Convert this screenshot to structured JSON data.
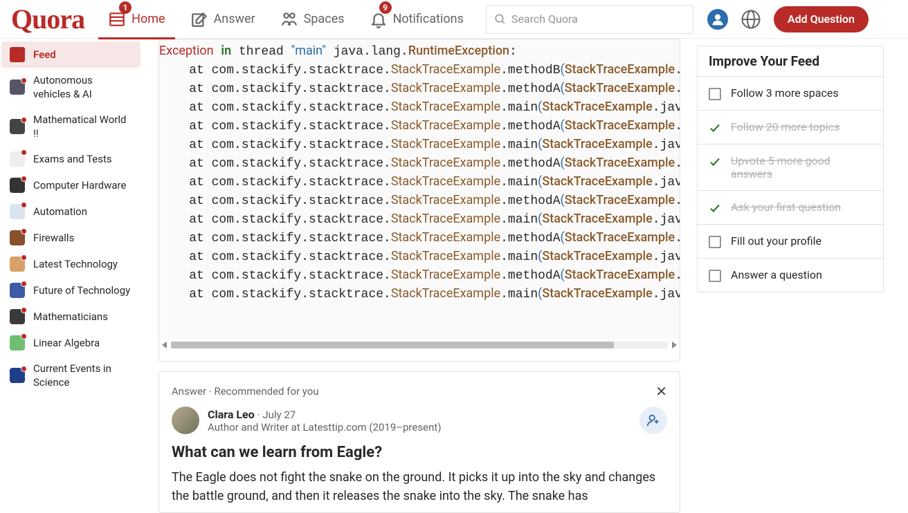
{
  "nav": {
    "logo": "Quora",
    "home": "Home",
    "answer": "Answer",
    "spaces": "Spaces",
    "notifications": "Notifications",
    "home_badge": "1",
    "notif_badge": "9",
    "search_placeholder": "Search Quora",
    "add_question": "Add Question"
  },
  "sidebar": {
    "feed": "Feed",
    "items": [
      "Autonomous vehicles & AI",
      "Mathematical World !!",
      "Exams and Tests",
      "Computer Hardware",
      "Automation",
      "Firewalls",
      "Latest Technology",
      "Future of Technology",
      "Mathematicians",
      "Linear Algebra",
      "Current Events in Science"
    ]
  },
  "code": {
    "lines": [
      {
        "pre": "",
        "at": "",
        "cls": "Exception",
        "kw": "in",
        "mid": "thread",
        "str": "\"main\"",
        "rest": "java.lang.",
        "ex": "RuntimeException",
        "tail": ":"
      },
      {
        "at": "    at com.stackify.stacktrace.",
        "cls": "StackTraceExample",
        "m": ".methodB",
        "paren": "(",
        "ex": "StackTraceExample",
        "tail": "."
      },
      {
        "at": "    at com.stackify.stacktrace.",
        "cls": "StackTraceExample",
        "m": ".methodA",
        "paren": "(",
        "ex": "StackTraceExample",
        "tail": "."
      },
      {
        "at": "    at com.stackify.stacktrace.",
        "cls": "StackTraceExample",
        "m": ".main",
        "paren": "(",
        "ex": "StackTraceExample",
        "tail": ".jav"
      },
      {
        "at": "    at com.stackify.stacktrace.",
        "cls": "StackTraceExample",
        "m": ".methodA",
        "paren": "(",
        "ex": "StackTraceExample",
        "tail": "."
      },
      {
        "at": "    at com.stackify.stacktrace.",
        "cls": "StackTraceExample",
        "m": ".main",
        "paren": "(",
        "ex": "StackTraceExample",
        "tail": ".jav"
      },
      {
        "at": "    at com.stackify.stacktrace.",
        "cls": "StackTraceExample",
        "m": ".methodA",
        "paren": "(",
        "ex": "StackTraceExample",
        "tail": "."
      },
      {
        "at": "    at com.stackify.stacktrace.",
        "cls": "StackTraceExample",
        "m": ".main",
        "paren": "(",
        "ex": "StackTraceExample",
        "tail": ".jav"
      },
      {
        "at": "    at com.stackify.stacktrace.",
        "cls": "StackTraceExample",
        "m": ".methodA",
        "paren": "(",
        "ex": "StackTraceExample",
        "tail": "."
      },
      {
        "at": "    at com.stackify.stacktrace.",
        "cls": "StackTraceExample",
        "m": ".main",
        "paren": "(",
        "ex": "StackTraceExample",
        "tail": ".jav"
      },
      {
        "at": "    at com.stackify.stacktrace.",
        "cls": "StackTraceExample",
        "m": ".methodA",
        "paren": "(",
        "ex": "StackTraceExample",
        "tail": "."
      },
      {
        "at": "    at com.stackify.stacktrace.",
        "cls": "StackTraceExample",
        "m": ".main",
        "paren": "(",
        "ex": "StackTraceExample",
        "tail": ".jav"
      },
      {
        "at": "    at com.stackify.stacktrace.",
        "cls": "StackTraceExample",
        "m": ".methodA",
        "paren": "(",
        "ex": "StackTraceExample",
        "tail": "."
      },
      {
        "at": "    at com.stackify.stacktrace.",
        "cls": "StackTraceExample",
        "m": ".main",
        "paren": "(",
        "ex": "StackTraceExample",
        "tail": ".jav"
      }
    ]
  },
  "answer": {
    "top": "Answer · Recommended for you",
    "name": "Clara Leo",
    "date": "July 27",
    "bio": "Author and Writer at Latesttip.com (2019–present)",
    "title": "What can we learn from Eagle?",
    "body": "The Eagle does not fight the snake on the ground. It picks it up into the sky and changes the battle ground, and then it releases the snake into the sky. The snake has"
  },
  "rail": {
    "title": "Improve Your Feed",
    "items": [
      {
        "done": false,
        "text": "Follow 3 more spaces"
      },
      {
        "done": true,
        "text": "Follow 20 more topics"
      },
      {
        "done": true,
        "text": "Upvote 5 more good answers"
      },
      {
        "done": true,
        "text": "Ask your first question"
      },
      {
        "done": false,
        "text": "Fill out your profile"
      },
      {
        "done": false,
        "text": "Answer a question"
      }
    ]
  }
}
